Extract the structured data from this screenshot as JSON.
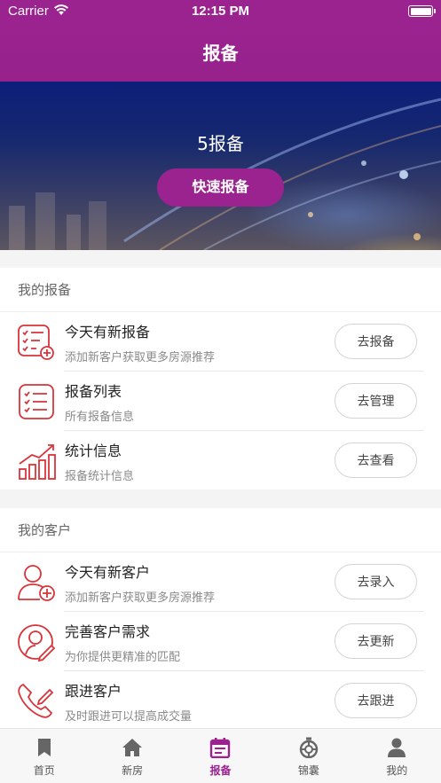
{
  "status_bar": {
    "carrier": "Carrier",
    "time": "12:15 PM"
  },
  "nav": {
    "title": "报备"
  },
  "banner": {
    "count_text": "5报备",
    "quick_button": "快速报备"
  },
  "sections": [
    {
      "title": "我的报备",
      "rows": [
        {
          "title": "今天有新报备",
          "subtitle": "添加新客户获取更多房源推荐",
          "button": "去报备",
          "icon": "checklist-add-icon"
        },
        {
          "title": "报备列表",
          "subtitle": "所有报备信息",
          "button": "去管理",
          "icon": "checklist-icon"
        },
        {
          "title": "统计信息",
          "subtitle": "报备统计信息",
          "button": "去查看",
          "icon": "bar-chart-icon"
        }
      ]
    },
    {
      "title": "我的客户",
      "rows": [
        {
          "title": "今天有新客户",
          "subtitle": "添加新客户获取更多房源推荐",
          "button": "去录入",
          "icon": "user-add-icon"
        },
        {
          "title": "完善客户需求",
          "subtitle": "为你提供更精准的匹配",
          "button": "去更新",
          "icon": "user-edit-icon"
        },
        {
          "title": "跟进客户",
          "subtitle": "及时跟进可以提高成交量",
          "button": "去跟进",
          "icon": "phone-edit-icon"
        }
      ]
    }
  ],
  "tabbar": {
    "active": 2,
    "items": [
      {
        "label": "首页",
        "icon": "bookmark-icon"
      },
      {
        "label": "新房",
        "icon": "house-icon"
      },
      {
        "label": "报备",
        "icon": "calendar-icon"
      },
      {
        "label": "锦囊",
        "icon": "stopwatch-icon"
      },
      {
        "label": "我的",
        "icon": "person-icon"
      }
    ]
  },
  "colors": {
    "brand": "#9b2390",
    "icon_red": "#d8343a"
  }
}
